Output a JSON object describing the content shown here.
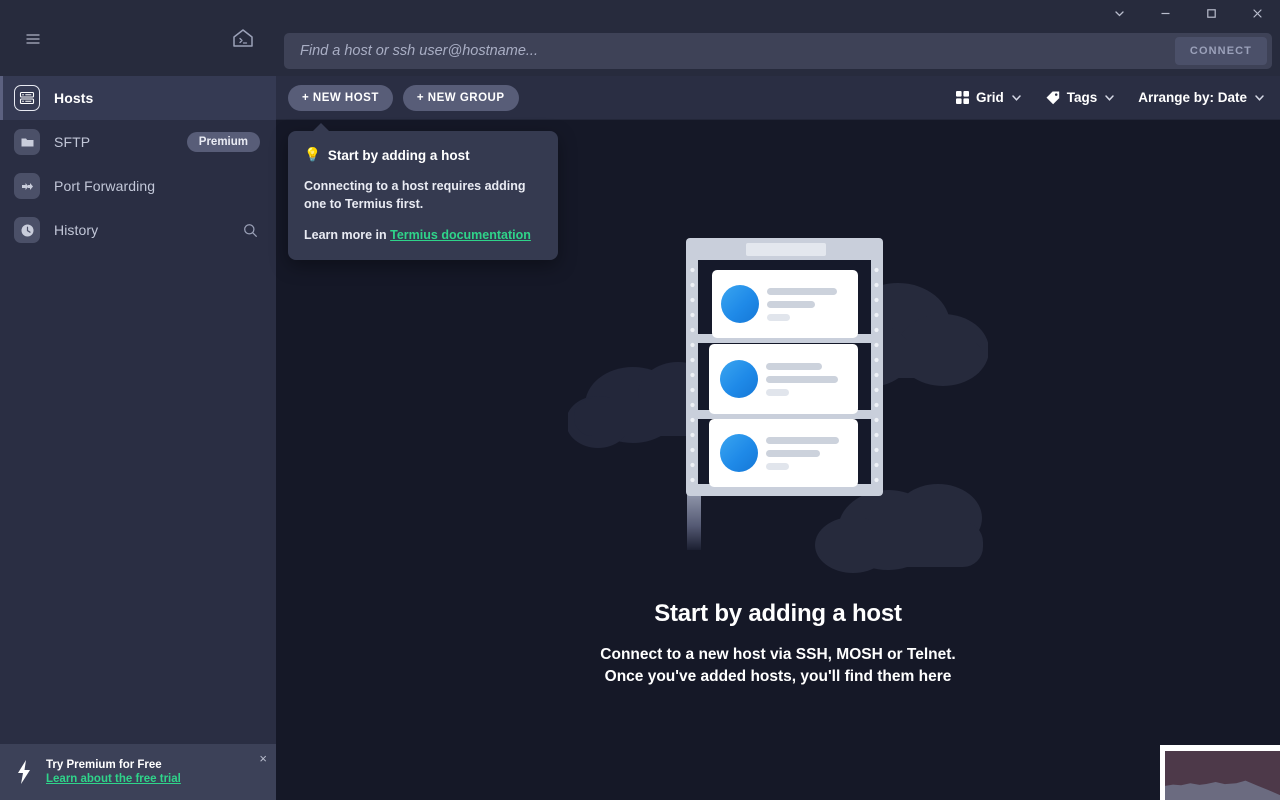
{
  "window": {
    "controls": [
      {
        "name": "chevron-down",
        "glyph": "chevron"
      },
      {
        "name": "minimize",
        "glyph": "minimize"
      },
      {
        "name": "maximize",
        "glyph": "maximize"
      },
      {
        "name": "close",
        "glyph": "close"
      }
    ]
  },
  "sidebar": {
    "menu_icon": "hamburger-menu-icon",
    "home_icon": "home-terminal-icon",
    "items": [
      {
        "label": "Hosts",
        "icon": "server-rack-icon",
        "active": true,
        "badge": ""
      },
      {
        "label": "SFTP",
        "icon": "folder-icon",
        "active": false,
        "badge": "Premium"
      },
      {
        "label": "Port Forwarding",
        "icon": "arrow-forward-icon",
        "active": false,
        "badge": ""
      },
      {
        "label": "History",
        "icon": "clock-icon",
        "active": false,
        "badge": ""
      }
    ],
    "history_search_icon": "search-icon",
    "promo": {
      "icon": "lightning-bolt-icon",
      "title": "Try Premium for Free",
      "link": "Learn about the free trial",
      "close": "×"
    }
  },
  "search": {
    "placeholder": "Find a host or ssh user@hostname...",
    "value": "",
    "connect_label": "CONNECT"
  },
  "toolbar": {
    "new_host_label": "+ NEW HOST",
    "new_group_label": "+ NEW GROUP",
    "view_label": "Grid",
    "view_icon": "grid-icon",
    "tags_label": "Tags",
    "tags_icon": "tag-icon",
    "arrange_label": "Arrange by: Date",
    "chevron_icon": "chevron-down-icon"
  },
  "popover": {
    "emoji": "💡",
    "title": "Start by adding a host",
    "body": "Connecting to a host requires adding one to Termius first.",
    "foot_prefix": "Learn more in ",
    "foot_link": "Termius documentation"
  },
  "empty_state": {
    "illustration": "server-rack-with-clouds-illustration",
    "title": "Start by adding a host",
    "subtitle_line1": "Connect to a new host via SSH, MOSH or Telnet.",
    "subtitle_line2": "Once you've added hosts, you'll find them here"
  },
  "colors": {
    "app_background": "#151827",
    "sidebar": "#2a2e43",
    "titlebar": "#272b3d",
    "search_field": "#3e4257",
    "accent_green": "#2fd48a",
    "pill": "#585d78",
    "active_row": "#353a53",
    "popover": "#353a50",
    "illustration_blue": "#2196f3"
  }
}
